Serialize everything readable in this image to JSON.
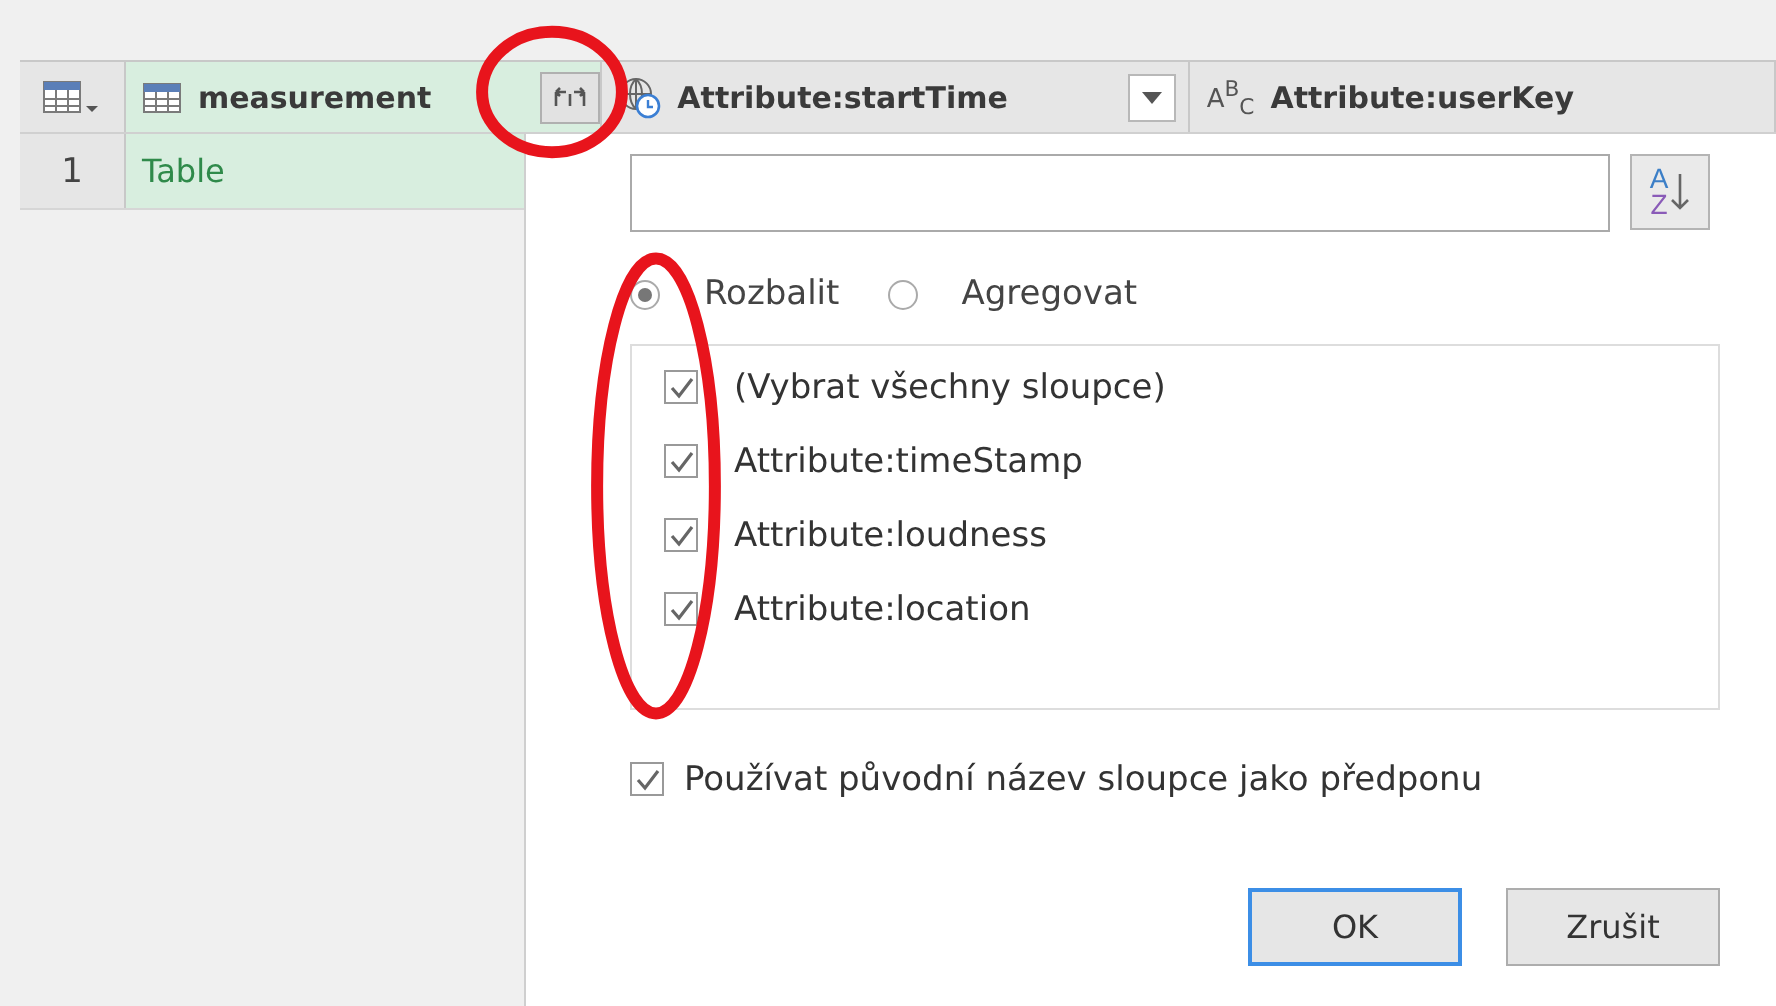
{
  "grid": {
    "columns": [
      {
        "label": "measurement",
        "kind": "table",
        "expand_button": true,
        "dropdown": false
      },
      {
        "label": "Attribute:startTime",
        "kind": "datetime",
        "expand_button": false,
        "dropdown": true
      },
      {
        "label": "Attribute:userKey",
        "kind": "text",
        "type_label": "A$^{B}$$_{C}$",
        "expand_button": false,
        "dropdown": false
      }
    ],
    "rows": [
      {
        "number": "1",
        "value": "Table"
      }
    ]
  },
  "expand_dialog": {
    "sort_button": {
      "top": "A",
      "bottom": "Z"
    },
    "modes": [
      {
        "label": "Rozbalit",
        "selected": true
      },
      {
        "label": "Agregovat",
        "selected": false
      }
    ],
    "columns": [
      {
        "label": "(Vybrat všechny sloupce)",
        "checked": true
      },
      {
        "label": "Attribute:timeStamp",
        "checked": true
      },
      {
        "label": "Attribute:loudness",
        "checked": true
      },
      {
        "label": "Attribute:location",
        "checked": true
      }
    ],
    "prefix_option": {
      "label": "Používat původní název sloupce jako předponu",
      "checked": true
    },
    "buttons": [
      {
        "label": "OK",
        "default": true
      },
      {
        "label": "Zrušit",
        "default": false
      }
    ]
  },
  "annotations": [
    {
      "kind": "ellipse"
    },
    {
      "kind": "ellipse"
    }
  ]
}
